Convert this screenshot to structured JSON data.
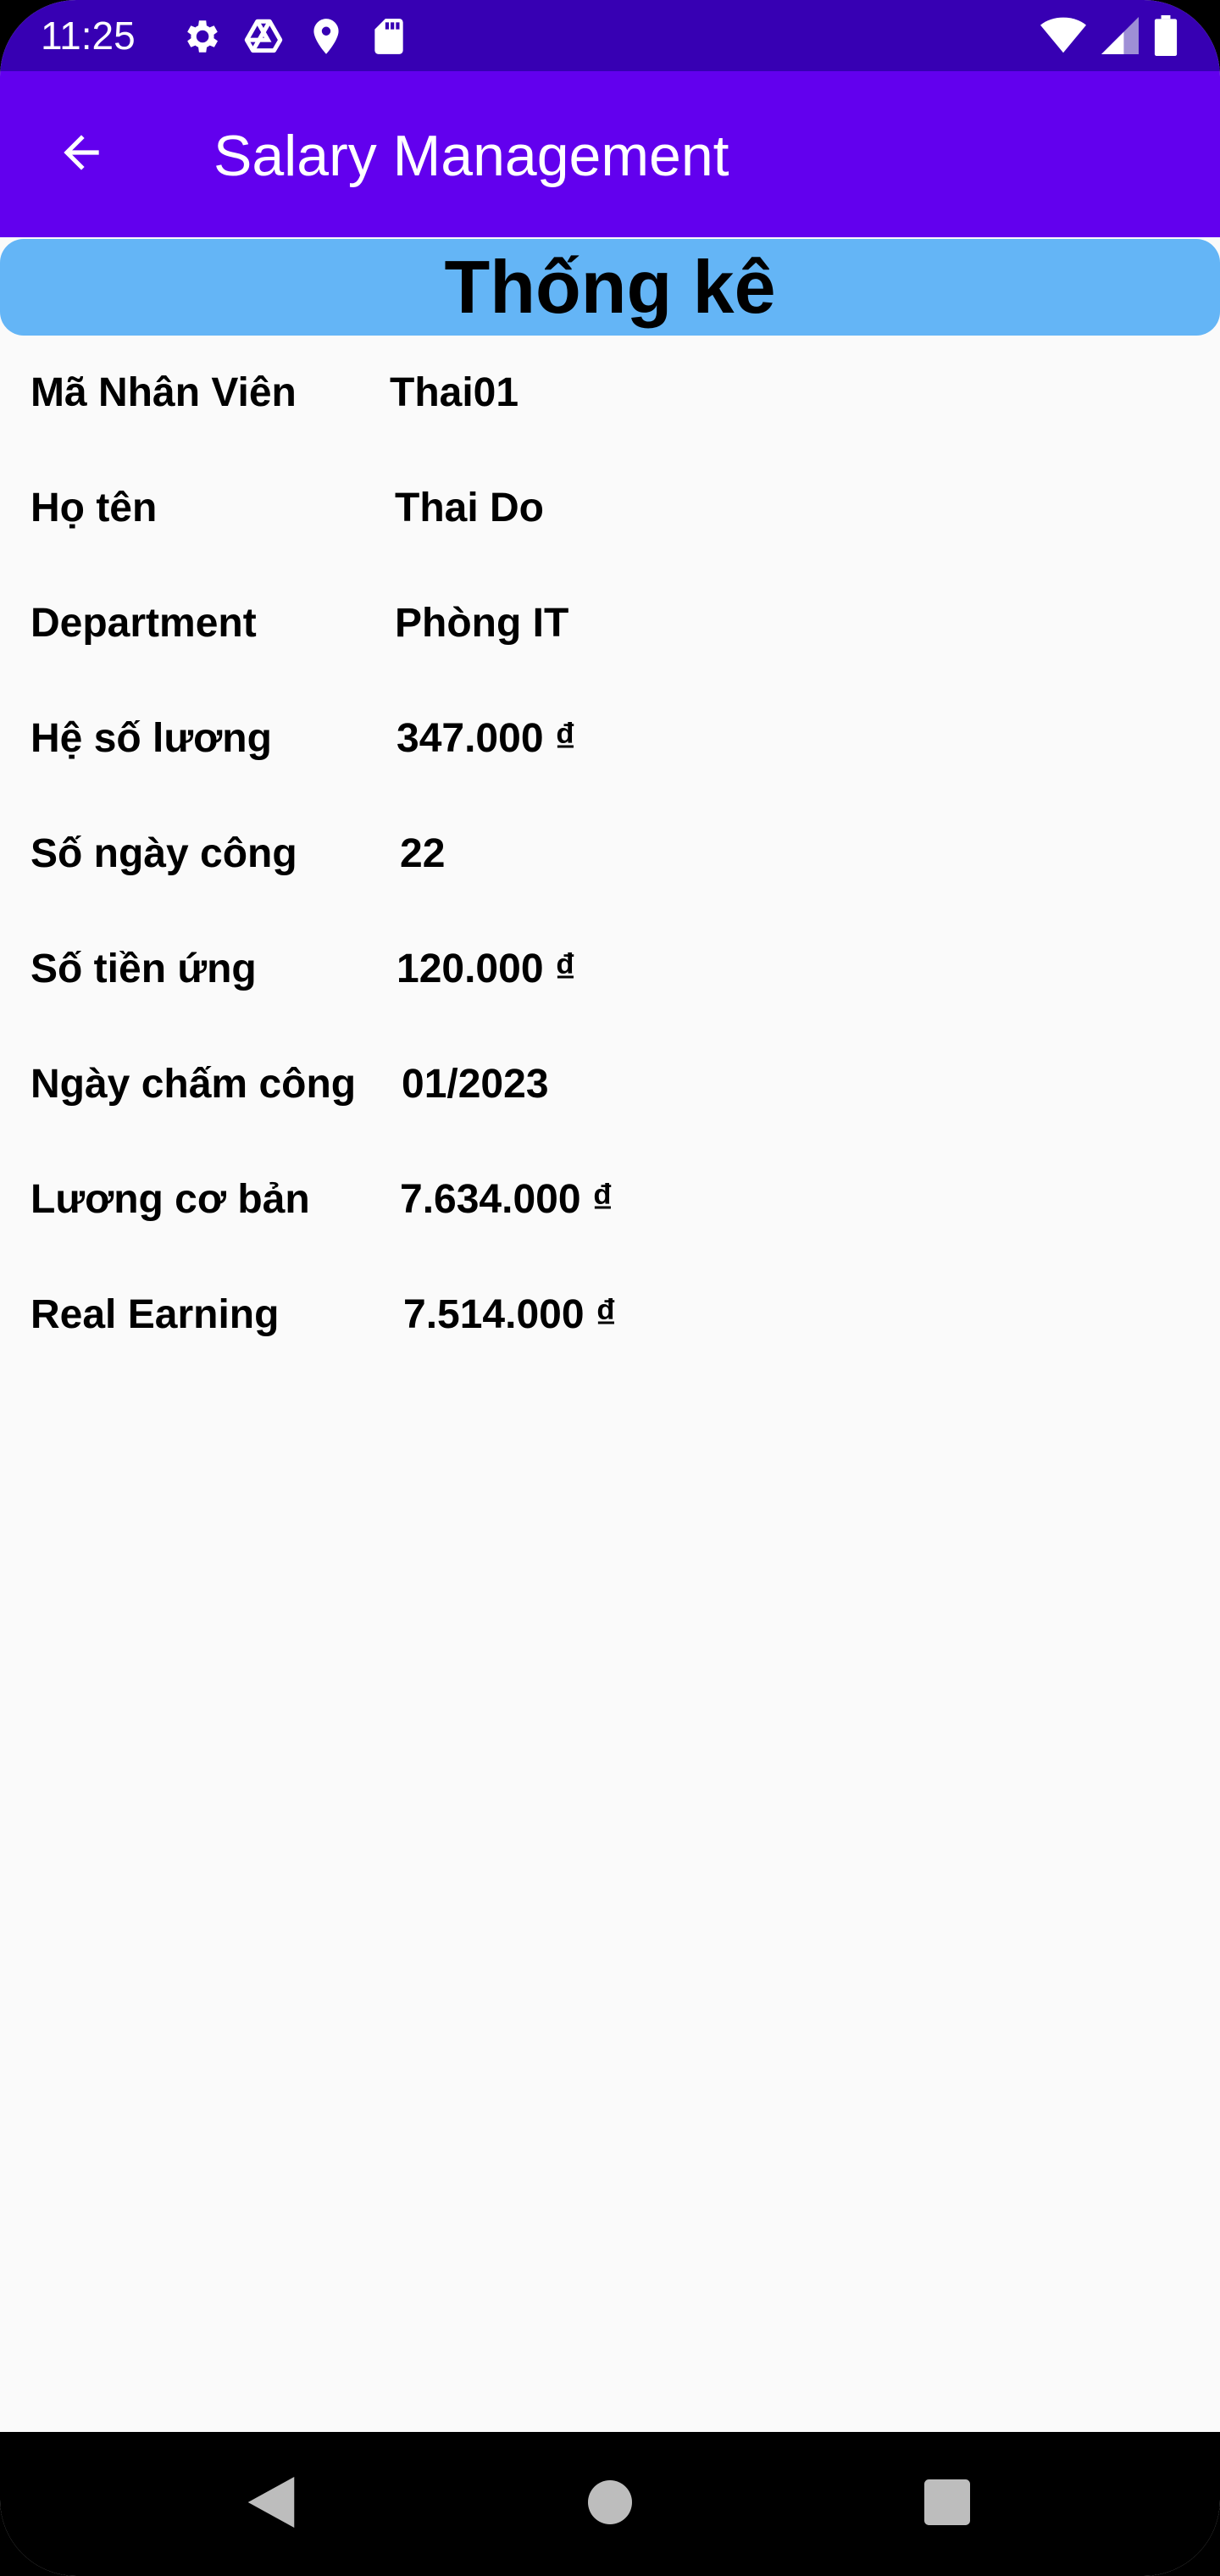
{
  "status_bar": {
    "time": "11:25",
    "icons": [
      "settings-icon",
      "drive-icon",
      "location-icon",
      "sd-card-icon"
    ],
    "right_icons": [
      "wifi-icon",
      "signal-icon",
      "battery-icon"
    ]
  },
  "app_bar": {
    "title": "Salary Management",
    "back_icon": "arrow-back-icon"
  },
  "banner": {
    "title": "Thống kê"
  },
  "fields": [
    {
      "label": "Mã Nhân Viên",
      "value": "Thai01"
    },
    {
      "label": "Họ tên",
      "value": "Thai Do"
    },
    {
      "label": "Department",
      "value": "Phòng IT"
    },
    {
      "label": "Hệ số lương",
      "value": "347.000 ₫"
    },
    {
      "label": "Số ngày công",
      "value": "22"
    },
    {
      "label": "Số tiền ứng",
      "value": "120.000 ₫"
    },
    {
      "label": "Ngày chấm công",
      "value": "01/2023"
    },
    {
      "label": "Lương cơ bản",
      "value": "7.634.000 ₫"
    },
    {
      "label": "Real Earning",
      "value": "7.514.000 ₫"
    }
  ],
  "colors": {
    "status_bar": "#3700b3",
    "app_bar": "#6200ee",
    "banner": "#64b5f6",
    "background": "#fafafa"
  },
  "nav_bar": {
    "buttons": [
      "back-triangle-icon",
      "home-circle-icon",
      "recents-square-icon"
    ]
  }
}
